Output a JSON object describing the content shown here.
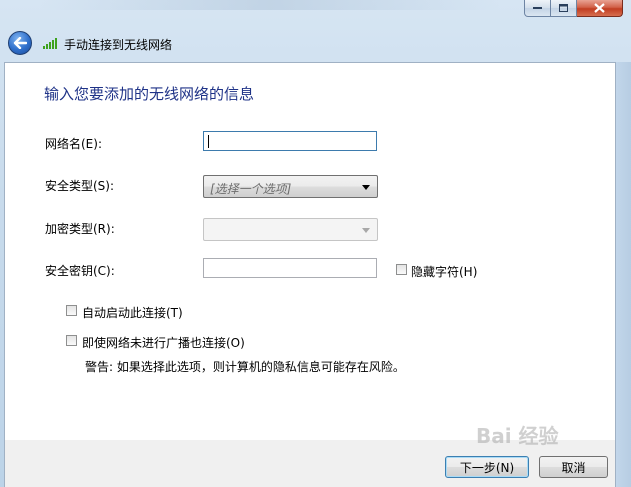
{
  "window": {
    "title": "手动连接到无线网络",
    "min_icon": "minimize-icon",
    "max_icon": "maximize-icon",
    "close_icon": "close-icon"
  },
  "nav": {
    "back_icon": "back-arrow-icon",
    "wifi_icon": "wireless-signal-icon"
  },
  "form": {
    "heading": "输入您要添加的无线网络的信息",
    "network_name_label": "网络名(E):",
    "network_name_value": "",
    "security_type_label": "安全类型(S):",
    "security_type_value": "[选择一个选项]",
    "encryption_type_label": "加密类型(R):",
    "encryption_type_value": "",
    "security_key_label": "安全密钥(C):",
    "security_key_value": "",
    "hide_chars_label": "隐藏字符(H)",
    "hide_chars_checked": false,
    "auto_start_label": "自动启动此连接(T)",
    "auto_start_checked": false,
    "connect_hidden_label": "即使网络未进行广播也连接(O)",
    "connect_hidden_checked": false,
    "warning": "警告: 如果选择此选项，则计算机的隐私信息可能存在风险。"
  },
  "buttons": {
    "next": "下一步(N)",
    "cancel": "取消"
  },
  "watermark": "Bai 经验"
}
